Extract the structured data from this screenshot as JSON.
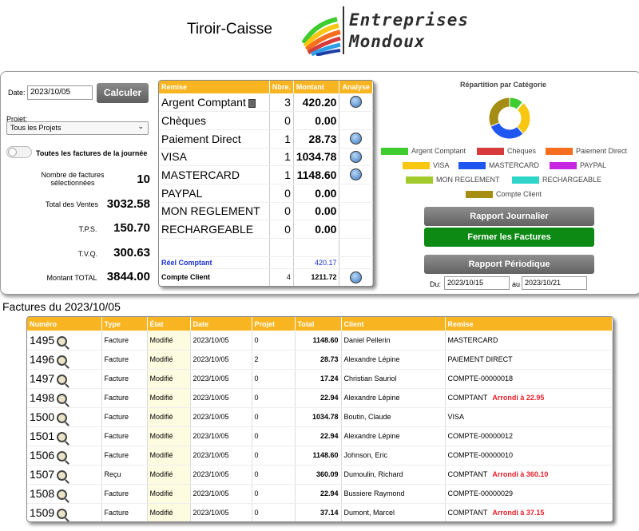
{
  "header": {
    "app_title": "Tiroir-Caisse",
    "logo_line1": "Entreprises",
    "logo_line2": "Mondoux"
  },
  "filters": {
    "date_label": "Date:",
    "date_value": "2023/10/05",
    "calc_label": "Calculer",
    "project_label": "Projet:",
    "project_value": "Tous les Projets",
    "toggle_label": "Toutes les factures de la journée"
  },
  "stats": {
    "count_label": "Nombre de factures sélectionnées",
    "count_value": "10",
    "sales_label": "Total des Ventes",
    "sales_value": "3032.58",
    "tps_label": "T.P.S.",
    "tps_value": "150.70",
    "tvq_label": "T.V.Q.",
    "tvq_value": "300.63",
    "total_label": "Montant TOTAL",
    "total_value": "3844.00"
  },
  "remise_table": {
    "headers": [
      "Remise",
      "Nbre.",
      "Montant",
      "Analyse"
    ],
    "rows": [
      {
        "name": "Argent Comptant",
        "count": "3",
        "amount": "420.20"
      },
      {
        "name": "Chèques",
        "count": "0",
        "amount": "0.00"
      },
      {
        "name": "Paiement Direct",
        "count": "1",
        "amount": "28.73"
      },
      {
        "name": "VISA",
        "count": "1",
        "amount": "1034.78"
      },
      {
        "name": "MASTERCARD",
        "count": "1",
        "amount": "1148.60"
      },
      {
        "name": "PAYPAL",
        "count": "0",
        "amount": "0.00"
      },
      {
        "name": "MON REGLEMENT",
        "count": "0",
        "amount": "0.00"
      },
      {
        "name": "RECHARGEABLE",
        "count": "0",
        "amount": "0.00"
      }
    ],
    "reel_label": "Réel Comptant",
    "reel_value": "420.17",
    "client_label": "Compte Client",
    "client_count": "4",
    "client_value": "1211.72"
  },
  "category": {
    "title": "Répartition par Catégorie",
    "legend": [
      {
        "label": "Argent Comptant",
        "color": "#3fcc2f"
      },
      {
        "label": "Chèques",
        "color": "#d63a3a"
      },
      {
        "label": "Paiement Direct",
        "color": "#f56f1e"
      },
      {
        "label": "VISA",
        "color": "#f7c712"
      },
      {
        "label": "MASTERCARD",
        "color": "#1f56f0"
      },
      {
        "label": "PAYPAL",
        "color": "#c528e0"
      },
      {
        "label": "MON REGLEMENT",
        "color": "#a2cb2c"
      },
      {
        "label": "RECHARGEABLE",
        "color": "#2fd5c8"
      },
      {
        "label": "Compte Client",
        "color": "#a48d12"
      }
    ]
  },
  "chart_data": {
    "type": "pie",
    "labels": [
      "Argent Comptant",
      "Chèques",
      "Paiement Direct",
      "VISA",
      "MASTERCARD",
      "PAYPAL",
      "MON REGLEMENT",
      "RECHARGEABLE",
      "Compte Client"
    ],
    "values": [
      420.2,
      0,
      28.73,
      1034.78,
      1148.6,
      0,
      0,
      0,
      1211.72
    ],
    "title": "Répartition par Catégorie"
  },
  "actions": {
    "daily_report": "Rapport Journalier",
    "close_invoices": "Fermer les Factures",
    "period_report": "Rapport Périodique",
    "from_label": "Du:",
    "from_value": "2023/10/15",
    "to_label": "au",
    "to_value": "2023/10/21"
  },
  "invoices": {
    "title": "Factures du 2023/10/05",
    "headers": [
      "Numéro",
      "Type",
      "État",
      "Date",
      "Projet",
      "Total",
      "Client",
      "Remise"
    ],
    "rows": [
      {
        "num": "1495",
        "type": "Facture",
        "etat": "Modifié",
        "date": "2023/10/05",
        "projet": "0",
        "total": "1148.60",
        "client": "Daniel Pellerin",
        "remise": "MASTERCARD",
        "arrondi": ""
      },
      {
        "num": "1496",
        "type": "Facture",
        "etat": "Modifié",
        "date": "2023/10/05",
        "projet": "2",
        "total": "28.73",
        "client": "Alexandre Lépine",
        "remise": "PAIEMENT DIRECT",
        "arrondi": ""
      },
      {
        "num": "1497",
        "type": "Facture",
        "etat": "Modifié",
        "date": "2023/10/05",
        "projet": "0",
        "total": "17.24",
        "client": "Christian Sauriol",
        "remise": "COMPTE-00000018",
        "arrondi": ""
      },
      {
        "num": "1498",
        "type": "Facture",
        "etat": "Modifié",
        "date": "2023/10/05",
        "projet": "0",
        "total": "22.94",
        "client": "Alexandre Lépine",
        "remise": "COMPTANT",
        "arrondi": "Arrondi à 22.95"
      },
      {
        "num": "1500",
        "type": "Facture",
        "etat": "Modifié",
        "date": "2023/10/05",
        "projet": "0",
        "total": "1034.78",
        "client": "Boutin, Claude",
        "remise": "VISA",
        "arrondi": ""
      },
      {
        "num": "1501",
        "type": "Facture",
        "etat": "Modifié",
        "date": "2023/10/05",
        "projet": "0",
        "total": "22.94",
        "client": "Alexandre Lépine",
        "remise": "COMPTE-00000012",
        "arrondi": ""
      },
      {
        "num": "1506",
        "type": "Facture",
        "etat": "Modifié",
        "date": "2023/10/05",
        "projet": "0",
        "total": "1148.60",
        "client": "Johnson, Eric",
        "remise": "COMPTE-00000010",
        "arrondi": ""
      },
      {
        "num": "1507",
        "type": "Reçu",
        "etat": "Modifié",
        "date": "2023/10/05",
        "projet": "0",
        "total": "360.09",
        "client": "Dumoulin, Richard",
        "remise": "COMPTANT",
        "arrondi": "Arrondi à 360.10"
      },
      {
        "num": "1508",
        "type": "Facture",
        "etat": "Modifié",
        "date": "2023/10/05",
        "projet": "0",
        "total": "22.94",
        "client": "Bussiere Raymond",
        "remise": "COMPTE-00000029",
        "arrondi": ""
      },
      {
        "num": "1509",
        "type": "Facture",
        "etat": "Modifié",
        "date": "2023/10/05",
        "projet": "0",
        "total": "37.14",
        "client": "Dumont, Marcel",
        "remise": "COMPTANT",
        "arrondi": "Arrondi à 37.15"
      }
    ]
  }
}
